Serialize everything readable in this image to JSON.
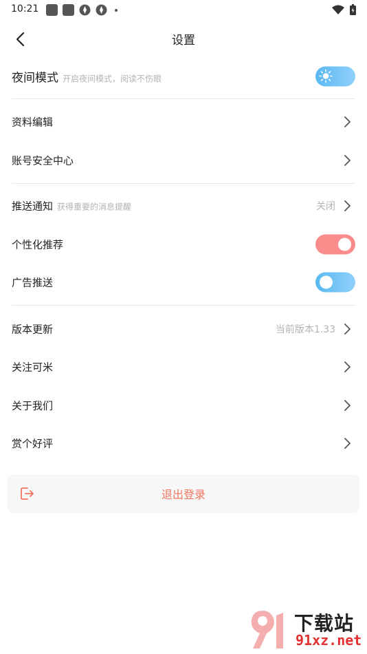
{
  "status_bar": {
    "time": "10:21"
  },
  "header": {
    "title": "设置"
  },
  "night_mode": {
    "label": "夜间模式",
    "sub": "开启夜间模式，阅读不伤眼"
  },
  "profile_edit": {
    "label": "资料编辑"
  },
  "account_security": {
    "label": "账号安全中心"
  },
  "push": {
    "label": "推送通知",
    "sub": "获得重要的消息提醒",
    "value": "关闭"
  },
  "personalized": {
    "label": "个性化推荐",
    "enabled": true
  },
  "ads_push": {
    "label": "广告推送",
    "enabled": false
  },
  "version": {
    "label": "版本更新",
    "value": "当前版本1.33"
  },
  "follow": {
    "label": "关注可米"
  },
  "about": {
    "label": "关于我们"
  },
  "rate": {
    "label": "赏个好评"
  },
  "logout": {
    "label": "退出登录"
  },
  "watermark": {
    "brand": "下载站",
    "url": "91xz.net"
  },
  "colors": {
    "accent_red": "#f07660",
    "toggle_blue": "#5ab8f2",
    "toggle_red": "#fb8c8c"
  }
}
